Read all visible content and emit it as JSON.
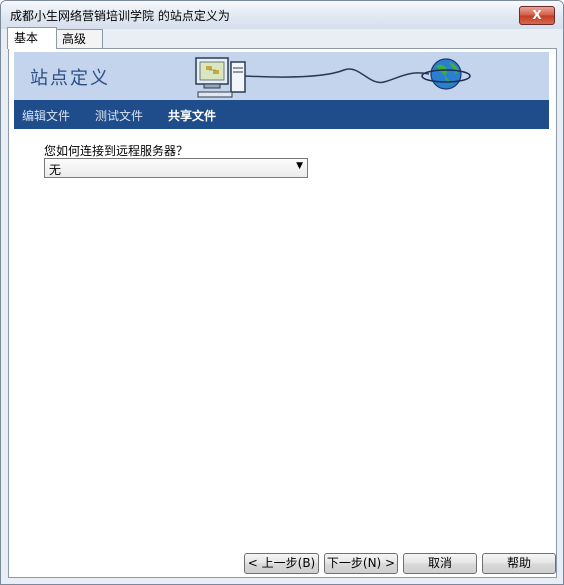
{
  "window": {
    "title": "成都小生网络营销培训学院 的站点定义为",
    "close_label": "X"
  },
  "tabs": [
    {
      "label": "基本",
      "active": true
    },
    {
      "label": "高级",
      "active": false
    }
  ],
  "banner": {
    "title": "站点定义"
  },
  "nav": {
    "items": [
      {
        "label": "编辑文件",
        "active": false
      },
      {
        "label": "测试文件",
        "active": false
      },
      {
        "label": "共享文件",
        "active": true
      }
    ]
  },
  "form": {
    "question": "您如何连接到远程服务器？",
    "select_value": "无"
  },
  "buttons": {
    "back": "< 上一步(B)",
    "next": "下一步(N) >",
    "cancel": "取消",
    "help": "帮助"
  },
  "colors": {
    "banner": "#c4d4ec",
    "nav_bg": "#1f4c8a",
    "close": "#c43b23"
  }
}
